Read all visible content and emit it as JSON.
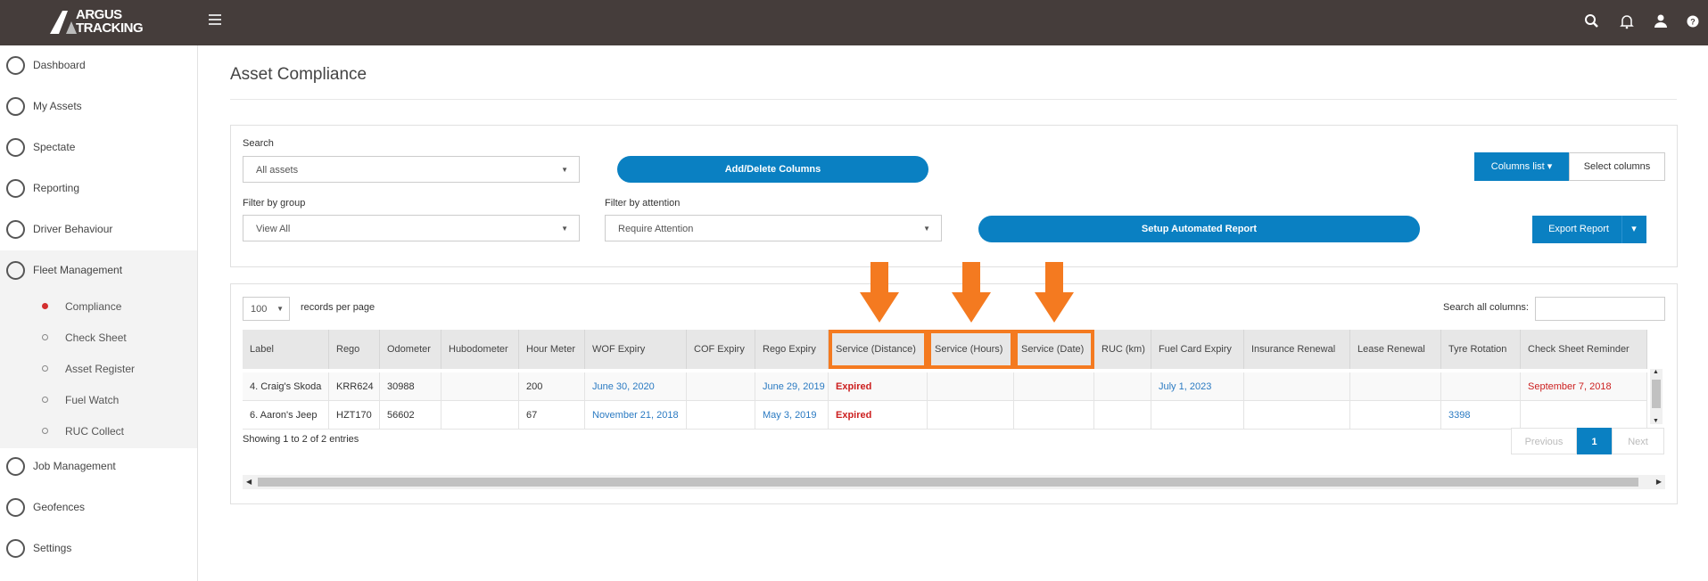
{
  "brand": {
    "line1": "ARGUS",
    "line2": "TRACKING"
  },
  "topbar": {
    "icons": [
      "search-icon",
      "bell-icon",
      "user-icon",
      "help-icon"
    ]
  },
  "sidebar": {
    "items": [
      {
        "label": "Dashboard",
        "icon": "dashboard-icon"
      },
      {
        "label": "My Assets",
        "icon": "assets-icon"
      },
      {
        "label": "Spectate",
        "icon": "map-pin-icon"
      },
      {
        "label": "Reporting",
        "icon": "reporting-icon"
      },
      {
        "label": "Driver Behaviour",
        "icon": "bulb-icon"
      },
      {
        "label": "Fleet Management",
        "icon": "truck-icon"
      },
      {
        "label": "Job Management",
        "icon": "briefcase-icon"
      },
      {
        "label": "Geofences",
        "icon": "geofence-icon"
      },
      {
        "label": "Settings",
        "icon": "gear-icon"
      }
    ],
    "fleet_sub": [
      {
        "label": "Compliance",
        "active": true
      },
      {
        "label": "Check Sheet",
        "active": false
      },
      {
        "label": "Asset Register",
        "active": false
      },
      {
        "label": "Fuel Watch",
        "active": false
      },
      {
        "label": "RUC Collect",
        "active": false
      }
    ]
  },
  "page": {
    "title": "Asset Compliance"
  },
  "filters": {
    "search_label": "Search",
    "search_value": "All assets",
    "add_delete_label": "Add/Delete Columns",
    "columns_list_label": "Columns list",
    "select_columns_label": "Select columns",
    "group_label": "Filter by group",
    "group_value": "View All",
    "attention_label": "Filter by attention",
    "attention_value": "Require Attention",
    "automated_report_label": "Setup Automated Report",
    "export_label": "Export Report"
  },
  "table": {
    "per_page_value": "100",
    "per_page_label": "records per page",
    "search_all_label": "Search all columns:",
    "headers": [
      "Label",
      "Rego",
      "Odometer",
      "Hubodometer",
      "Hour Meter",
      "WOF Expiry",
      "COF Expiry",
      "Rego Expiry",
      "Service (Distance)",
      "Service (Hours)",
      "Service (Date)",
      "RUC (km)",
      "Fuel Card Expiry",
      "Insurance Renewal",
      "Lease Renewal",
      "Tyre Rotation",
      "Check Sheet Reminder"
    ],
    "rows": [
      [
        "4. Craig's Skoda",
        "KRR624",
        "30988",
        "",
        "200",
        "June 30, 2020",
        "",
        "June 29, 2019",
        "Expired",
        "",
        "",
        "",
        "July 1, 2023",
        "",
        "",
        "",
        "September 7, 2018"
      ],
      [
        "6. Aaron's Jeep",
        "HZT170",
        "56602",
        "",
        "67",
        "November 21, 2018",
        "",
        "May 3, 2019",
        "Expired",
        "",
        "",
        "",
        "",
        "",
        "",
        "3398",
        ""
      ]
    ],
    "showing": "Showing 1 to 2 of 2 entries",
    "pager": {
      "previous": "Previous",
      "current": "1",
      "next": "Next"
    }
  },
  "colors": {
    "accent": "#0a80c2",
    "highlight": "#f47a20",
    "topbar": "#453d3b",
    "expired": "#cc1f1f"
  }
}
